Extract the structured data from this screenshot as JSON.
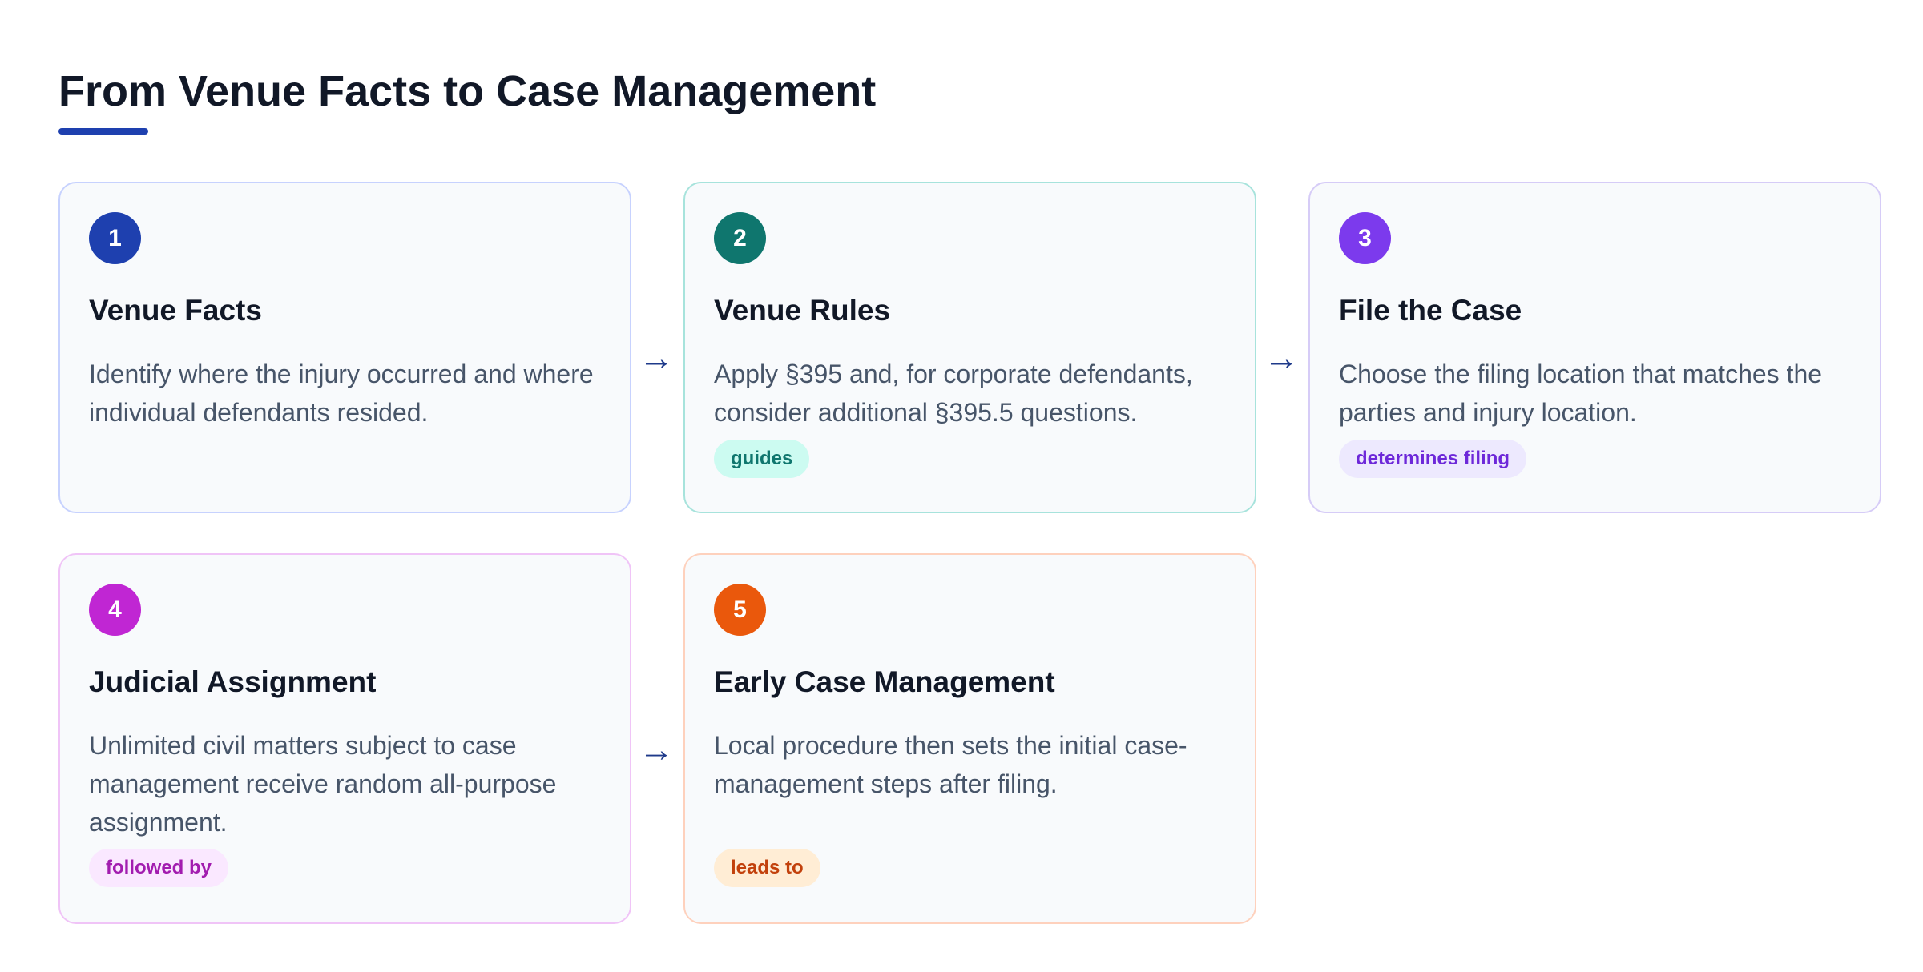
{
  "title": "From Venue Facts to Case Management",
  "steps": [
    {
      "number": "1",
      "heading": "Venue Facts",
      "description": "Identify where the injury occurred and where individual defendants resided.",
      "tag": "",
      "color": "#1e40af",
      "border": "#c7d2fe"
    },
    {
      "number": "2",
      "heading": "Venue Rules",
      "description": "Apply §395 and, for corporate defendants, consider additional §395.5 questions.",
      "tag": "guides",
      "color": "#0f766e",
      "border": "#a7e3dc",
      "tag_bg": "#ccfbf1",
      "tag_color": "#0f766e"
    },
    {
      "number": "3",
      "heading": "File the Case",
      "description": "Choose the filing location that matches the parties and injury location.",
      "tag": "determines filing",
      "color": "#7c3aed",
      "border": "#d6ccf7",
      "tag_bg": "#ede9fe",
      "tag_color": "#6d28d9"
    },
    {
      "number": "4",
      "heading": "Judicial Assignment",
      "description": "Unlimited civil matters subject to case management receive random all-purpose assignment.",
      "tag": "followed by",
      "color": "#c026d3",
      "border": "#f0c4f7",
      "tag_bg": "#fae8ff",
      "tag_color": "#a21caf"
    },
    {
      "number": "5",
      "heading": "Early Case Management",
      "description": "Local procedure then sets the initial case-management steps after filing.",
      "tag": "leads to",
      "color": "#ea580c",
      "border": "#fed1bd",
      "tag_bg": "#ffedd5",
      "tag_color": "#c2410c"
    }
  ],
  "arrow_symbol": "→",
  "accent_color": "#1e40af"
}
